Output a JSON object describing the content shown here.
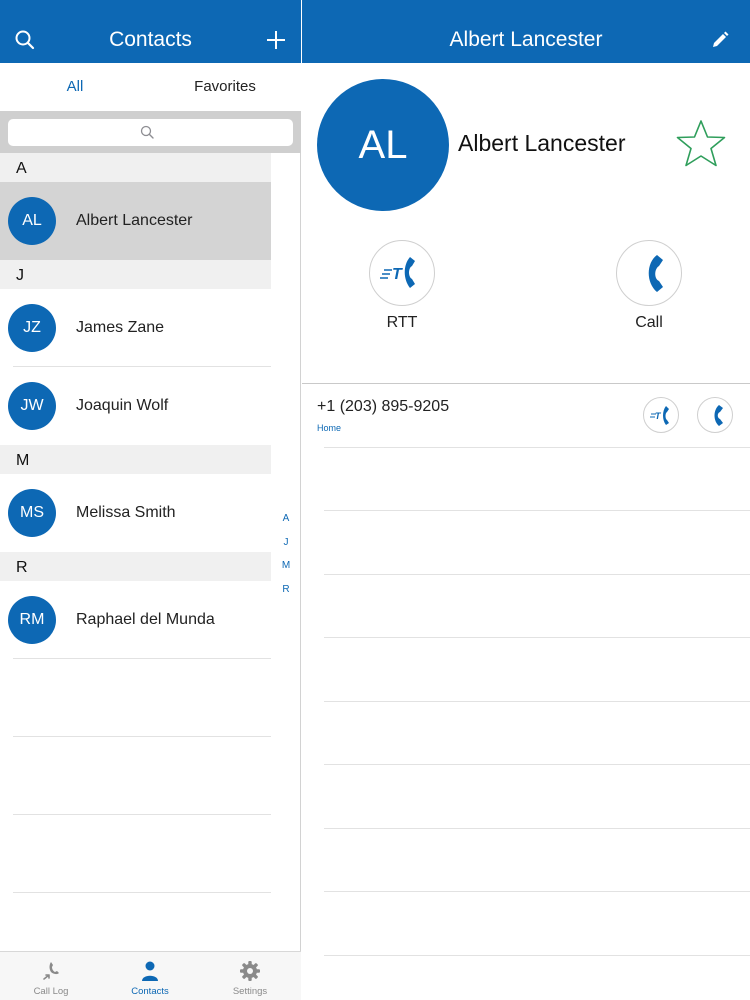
{
  "left": {
    "title": "Contacts",
    "tabs": [
      {
        "label": "All",
        "active": true
      },
      {
        "label": "Favorites",
        "active": false
      }
    ],
    "sections": [
      {
        "letter": "A",
        "contacts": [
          {
            "initials": "AL",
            "name": "Albert Lancester",
            "selected": true
          }
        ]
      },
      {
        "letter": "J",
        "contacts": [
          {
            "initials": "JZ",
            "name": "James Zane"
          },
          {
            "initials": "JW",
            "name": "Joaquin Wolf"
          }
        ]
      },
      {
        "letter": "M",
        "contacts": [
          {
            "initials": "MS",
            "name": "Melissa Smith"
          }
        ]
      },
      {
        "letter": "R",
        "contacts": [
          {
            "initials": "RM",
            "name": "Raphael del Munda"
          }
        ]
      }
    ],
    "index": [
      "A",
      "J",
      "M",
      "R"
    ]
  },
  "tabbar": [
    {
      "label": "Call Log",
      "icon": "call-log-icon",
      "active": false
    },
    {
      "label": "Contacts",
      "icon": "person-icon",
      "active": true
    },
    {
      "label": "Settings",
      "icon": "gear-icon",
      "active": false
    }
  ],
  "detail": {
    "title": "Albert Lancester",
    "initials": "AL",
    "name": "Albert Lancester",
    "actions": [
      {
        "label": "RTT",
        "icon": "rtt-icon"
      },
      {
        "label": "Call",
        "icon": "phone-icon"
      }
    ],
    "phone": {
      "number": "+1 (203) 895-9205",
      "type": "Home"
    }
  },
  "colors": {
    "accent": "#0d68b4",
    "star": "#2f9e5b"
  }
}
